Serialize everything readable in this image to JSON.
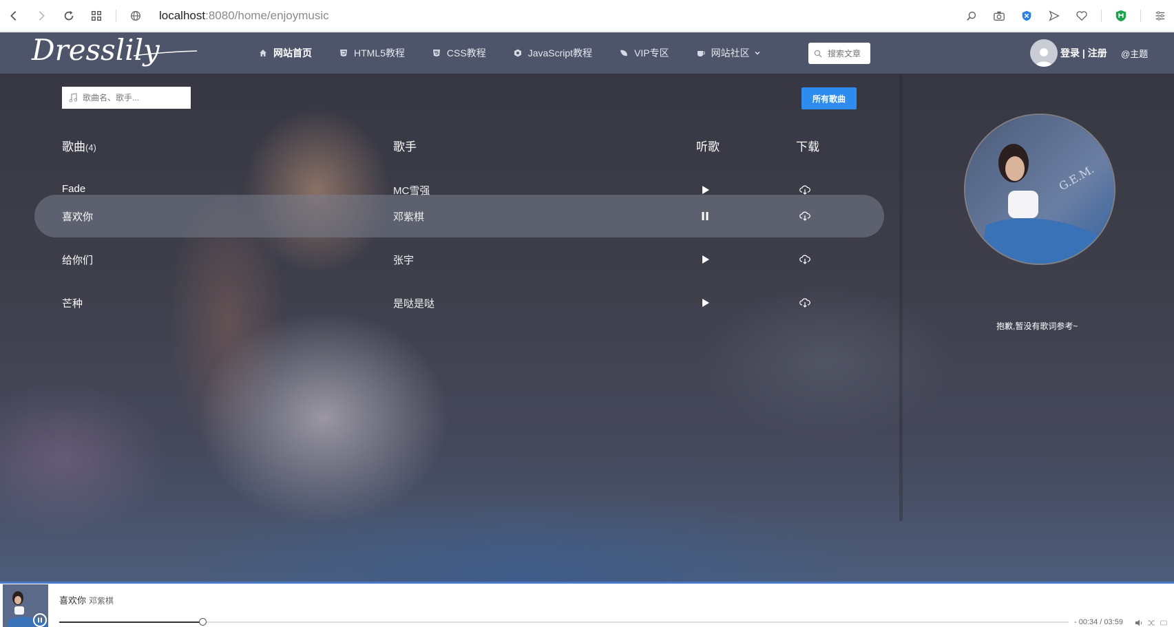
{
  "browser": {
    "url_host": "localhost",
    "url_rest": ":8080/home/enjoymusic",
    "icons": [
      "back-icon",
      "forward-icon",
      "reload-icon",
      "grid-icon",
      "globe-icon",
      "search-icon",
      "camera-icon",
      "shield-icon",
      "send-icon",
      "heart-icon",
      "adblock-icon",
      "menu-icon"
    ]
  },
  "navbar": {
    "logo_text": "Dresslily",
    "items": [
      {
        "label": "网站首页",
        "icon": "home-icon"
      },
      {
        "label": "HTML5教程",
        "icon": "html5-icon"
      },
      {
        "label": "CSS教程",
        "icon": "css-icon"
      },
      {
        "label": "JavaScript教程",
        "icon": "js-icon"
      },
      {
        "label": "VIP专区",
        "icon": "vip-icon"
      },
      {
        "label": "网站社区",
        "icon": "community-icon"
      }
    ],
    "search_placeholder": "搜索文章",
    "login": "登录 | 注册",
    "theme": "@主题"
  },
  "music": {
    "search_placeholder": "歌曲名、歌手...",
    "all_songs": "所有歌曲",
    "headers": {
      "song": "歌曲",
      "count": "(4)",
      "singer": "歌手",
      "listen": "听歌",
      "download": "下载"
    },
    "songs": [
      {
        "name": "Fade",
        "singer": "MC雪强",
        "playing": false
      },
      {
        "name": "喜欢你",
        "singer": "邓紫棋",
        "playing": true
      },
      {
        "name": "给你们",
        "singer": "张宇",
        "playing": false
      },
      {
        "name": "芒种",
        "singer": "是哒是哒",
        "playing": false
      }
    ],
    "lyric_note": "抱歉,暂没有歌词参考~",
    "cover_text": "喜欢你 G.E.M.邓紫棋"
  },
  "player": {
    "title": "喜欢你",
    "artist": "邓紫棋",
    "time": "- 00:34 / 03:59",
    "progress": 0.142
  },
  "colors": {
    "accent": "#2f8cef",
    "navbar": "#505870",
    "player_border": "#4a78c8"
  }
}
